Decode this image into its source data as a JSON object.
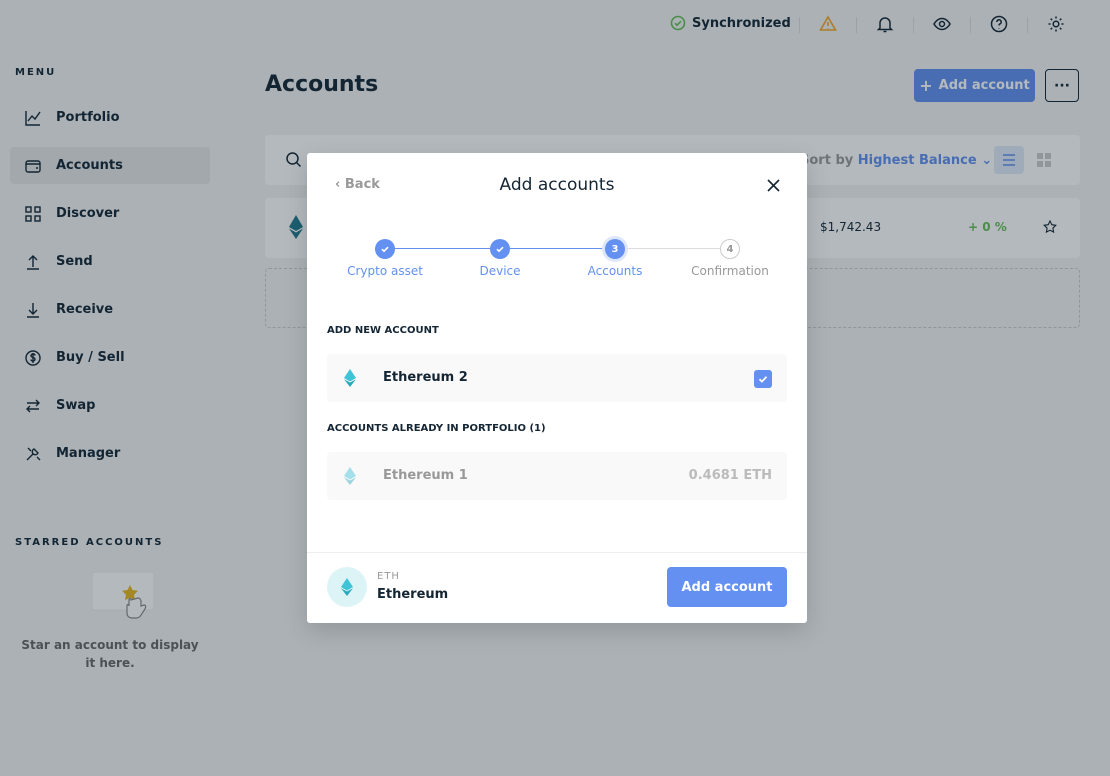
{
  "window": {
    "controls": [
      "#ff5f57",
      "#febc2e",
      "#28c840"
    ]
  },
  "sidebar": {
    "menu_label": "MENU",
    "items": [
      {
        "label": "Portfolio",
        "icon": "chart-line-icon",
        "active": false
      },
      {
        "label": "Accounts",
        "icon": "wallet-icon",
        "active": true
      },
      {
        "label": "Discover",
        "icon": "grid-icon",
        "active": false
      },
      {
        "label": "Send",
        "icon": "arrow-up-icon",
        "active": false
      },
      {
        "label": "Receive",
        "icon": "arrow-down-icon",
        "active": false
      },
      {
        "label": "Buy / Sell",
        "icon": "dollar-icon",
        "active": false
      },
      {
        "label": "Swap",
        "icon": "swap-icon",
        "active": false
      },
      {
        "label": "Manager",
        "icon": "tools-icon",
        "active": false
      }
    ],
    "starred_label": "STARRED ACCOUNTS",
    "starred_empty": "Star an account to display it here."
  },
  "topbar": {
    "sync_label": "Synchronized",
    "icons": [
      "warning-icon",
      "bell-icon",
      "eye-icon",
      "help-icon",
      "gear-icon"
    ]
  },
  "main": {
    "title": "Accounts",
    "add_account_label": "Add account",
    "sort_label": "Sort by",
    "sort_value": "Highest Balance",
    "account_row": {
      "balance": "$1,742.43",
      "change": "+ 0 %"
    }
  },
  "modal": {
    "back_label": "Back",
    "title": "Add accounts",
    "steps": [
      {
        "label": "Crypto asset",
        "number": "1",
        "state": "done"
      },
      {
        "label": "Device",
        "number": "2",
        "state": "done"
      },
      {
        "label": "Accounts",
        "number": "3",
        "state": "active"
      },
      {
        "label": "Confirmation",
        "number": "4",
        "state": "pending"
      }
    ],
    "new_section_label": "ADD NEW ACCOUNT",
    "new_account": {
      "name": "Ethereum 2",
      "checked": true
    },
    "existing_section_label": "ACCOUNTS ALREADY IN PORTFOLIO (1)",
    "existing_account": {
      "name": "Ethereum 1",
      "balance": "0.4681 ETH"
    },
    "footer": {
      "ticker": "ETH",
      "currency": "Ethereum",
      "button_label": "Add account"
    }
  },
  "colors": {
    "accent": "#6490f1",
    "eth": "#3fc3d6",
    "positive": "#66be54",
    "warning": "#f5a623",
    "success": "#66be54"
  }
}
